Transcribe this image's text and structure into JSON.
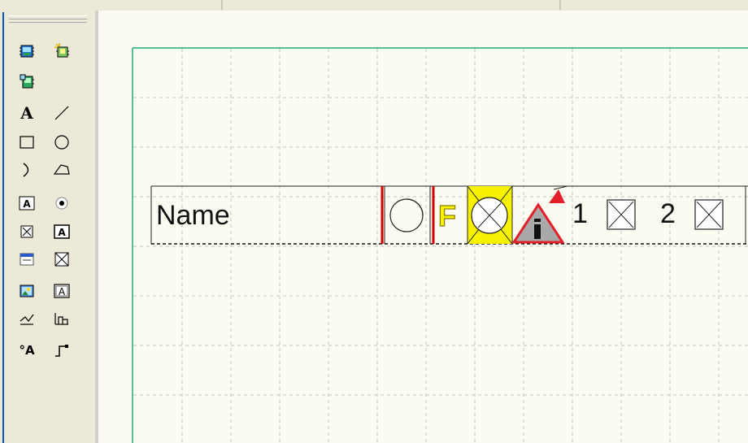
{
  "toolbar": {
    "tools": [
      {
        "name": "component-a-icon"
      },
      {
        "name": "component-b-icon"
      },
      {
        "name": "component-c-icon"
      },
      {
        "name": "text-tool-icon",
        "glyph": "A"
      },
      {
        "name": "line-tool-icon"
      },
      {
        "name": "rectangle-tool-icon"
      },
      {
        "name": "ellipse-tool-icon"
      },
      {
        "name": "arc-tool-icon"
      },
      {
        "name": "polygon-tool-icon"
      },
      {
        "name": "label-field-tool-icon",
        "glyph": "A"
      },
      {
        "name": "radio-tool-icon"
      },
      {
        "name": "checkbox-tool-icon"
      },
      {
        "name": "textbox-tool-icon",
        "glyph": "A"
      },
      {
        "name": "window-tool-icon"
      },
      {
        "name": "crossbox-tool-icon"
      },
      {
        "name": "picture-tool-icon"
      },
      {
        "name": "framed-text-tool-icon",
        "glyph": "A"
      },
      {
        "name": "trend-tool-icon"
      },
      {
        "name": "bar-tool-icon"
      },
      {
        "name": "alarm-text-tool-icon",
        "glyph": "°A"
      },
      {
        "name": "step-tool-icon"
      }
    ]
  },
  "canvas": {
    "row": {
      "name_label": "Name",
      "number_1": "1",
      "number_2": "2",
      "flag_letter": "F"
    },
    "colors": {
      "page_border": "#1fae6d",
      "grid": "#bdbdbd",
      "red_marker": "#d40000",
      "yellow_highlight": "#f7f300",
      "warning_red": "#e3202a",
      "warning_fill": "#a9a9a9"
    }
  }
}
